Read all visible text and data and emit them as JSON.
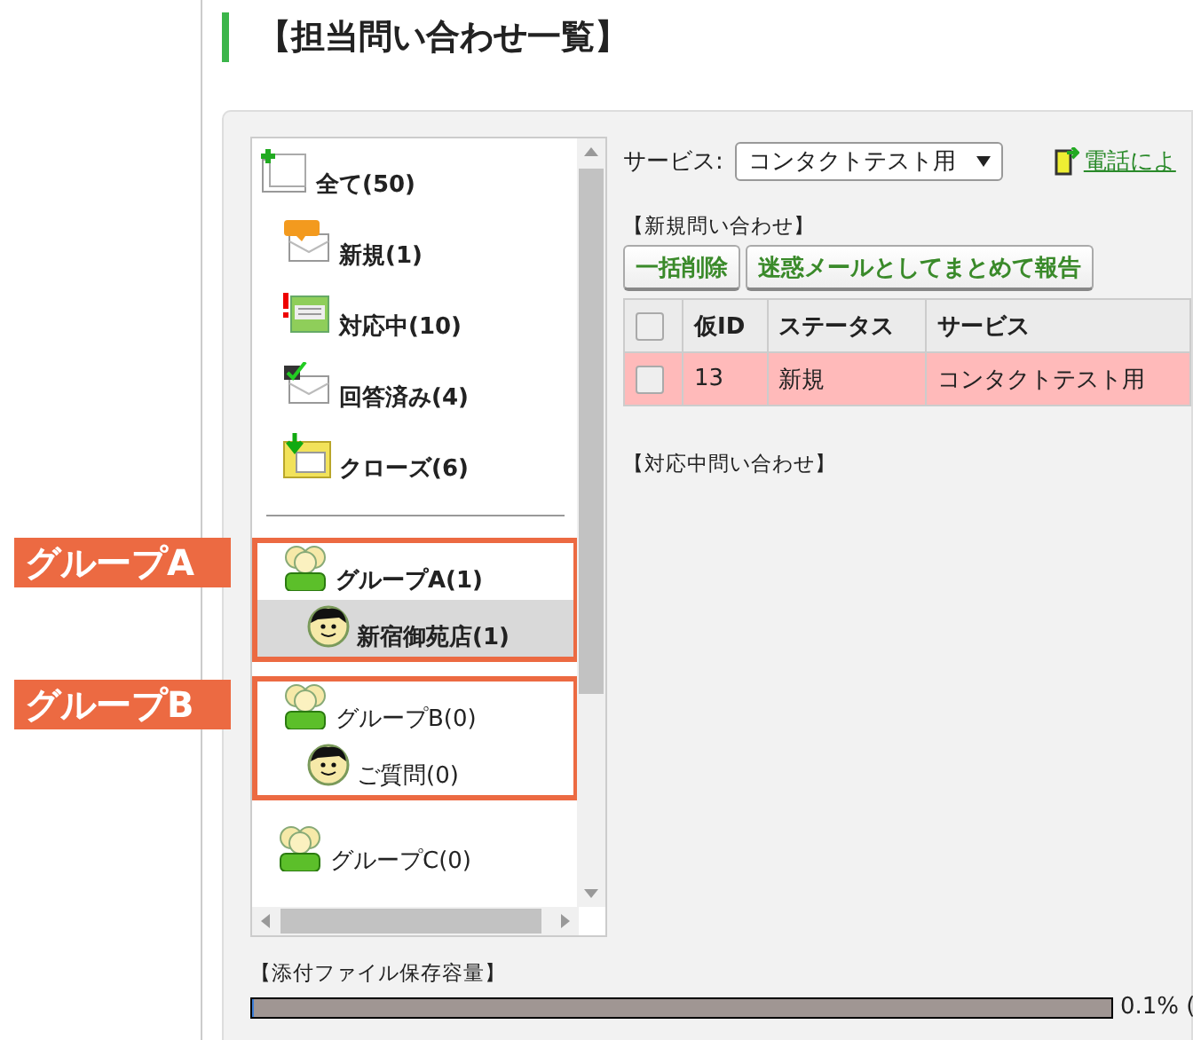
{
  "page_title": "【担当問い合わせ一覧】",
  "tree": {
    "status_items": [
      {
        "label": "全て(50)",
        "kind": "all",
        "bold": true,
        "selected": false,
        "children": [
          {
            "label": "新規(1)",
            "kind": "new",
            "bold": true,
            "selected": false
          },
          {
            "label": "対応中(10)",
            "kind": "in_progress",
            "bold": true,
            "selected": false
          },
          {
            "label": "回答済み(4)",
            "kind": "answered",
            "bold": true,
            "selected": false
          },
          {
            "label": "クローズ(6)",
            "kind": "closed",
            "bold": true,
            "selected": false
          }
        ]
      }
    ],
    "groups": [
      {
        "label": "グループA(1)",
        "bold": true,
        "selected": false,
        "annotation": "グループA",
        "children": [
          {
            "label": "新宿御苑店(1)",
            "bold": true,
            "selected": true
          }
        ]
      },
      {
        "label": "グループB(0)",
        "bold": false,
        "selected": false,
        "annotation": "グループB",
        "children": [
          {
            "label": "ご質問(0)",
            "bold": false,
            "selected": false
          }
        ]
      },
      {
        "label": "グループC(0)",
        "bold": false,
        "selected": false
      }
    ]
  },
  "service": {
    "label": "サービス:",
    "value": "コンタクトテスト用"
  },
  "phone_link": "電話によ",
  "new_section": {
    "title": "【新規問い合わせ】",
    "buttons": [
      "一括削除",
      "迷惑メールとしてまとめて報告"
    ],
    "table": {
      "columns": [
        "仮ID",
        "ステータス",
        "サービス"
      ],
      "header_checked": false,
      "rows": [
        {
          "checked": false,
          "cells": [
            "13",
            "新規",
            "コンタクトテスト用"
          ]
        }
      ]
    }
  },
  "in_progress_section": {
    "title": "【対応中問い合わせ】"
  },
  "storage": {
    "title": "【添付ファイル保存容量】",
    "level": 0.001,
    "reading": "0.1% ("
  }
}
